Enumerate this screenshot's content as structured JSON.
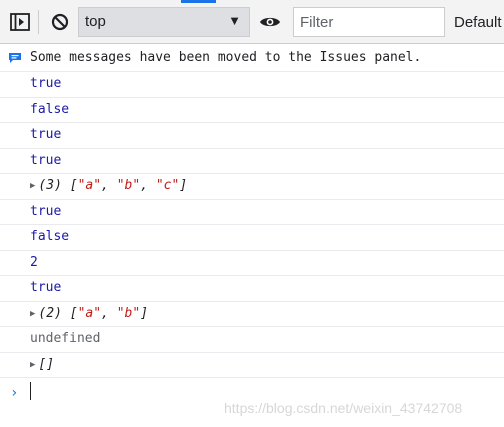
{
  "toolbar": {
    "context": "top",
    "filter_placeholder": "Filter",
    "levels_label": "Default",
    "accent_color": "#1a73e8"
  },
  "icons": [
    "sidebar-toggle-icon",
    "clear-console-icon",
    "eye-icon",
    "dropdown-arrow-icon",
    "info-icon",
    "chevron-right-icon",
    "expand-triangle-icon"
  ],
  "console": {
    "info_message": "Some messages have been moved to the Issues panel.",
    "rows": [
      {
        "type": "bool",
        "text": "true"
      },
      {
        "type": "bool",
        "text": "false"
      },
      {
        "type": "bool",
        "text": "true"
      },
      {
        "type": "bool",
        "text": "true"
      },
      {
        "type": "array",
        "count": "(3)",
        "items": [
          "\"a\"",
          "\"b\"",
          "\"c\""
        ]
      },
      {
        "type": "bool",
        "text": "true"
      },
      {
        "type": "bool",
        "text": "false"
      },
      {
        "type": "num",
        "text": "2"
      },
      {
        "type": "bool",
        "text": "true"
      },
      {
        "type": "array",
        "count": "(2)",
        "items": [
          "\"a\"",
          "\"b\""
        ]
      },
      {
        "type": "undef",
        "text": "undefined"
      },
      {
        "type": "array",
        "count": "",
        "items": []
      }
    ]
  },
  "watermark": "https://blog.csdn.net/weixin_43742708"
}
